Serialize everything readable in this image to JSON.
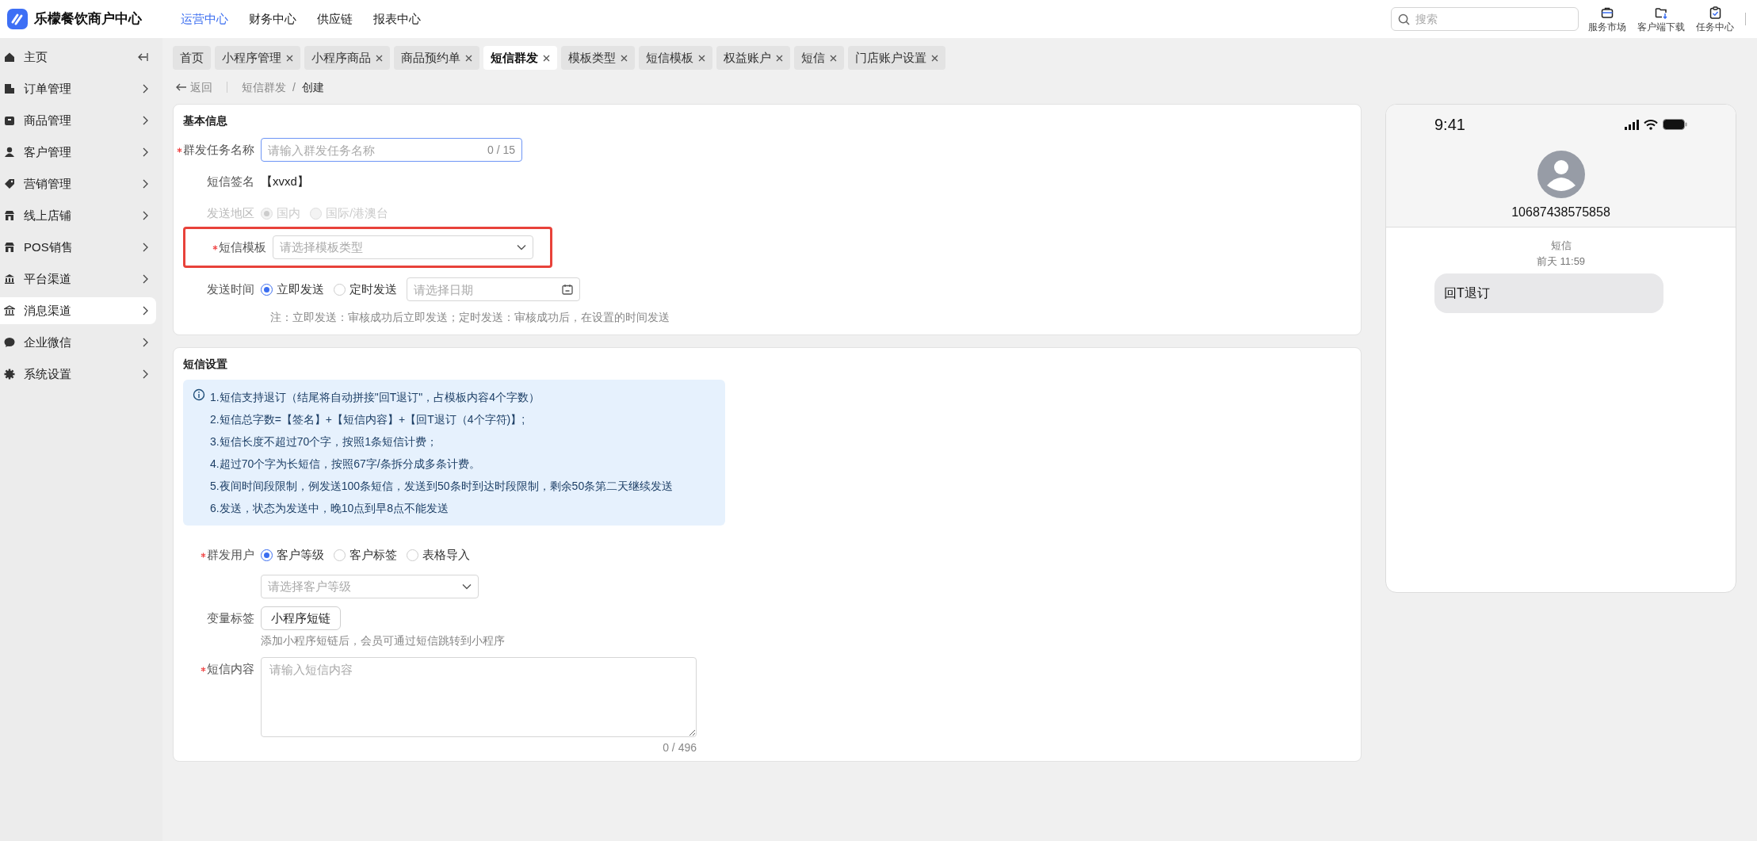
{
  "app": {
    "name": "乐檬餐饮商户中心"
  },
  "top_nav": [
    {
      "label": "运营中心",
      "selected": true
    },
    {
      "label": "财务中心",
      "selected": false
    },
    {
      "label": "供应链",
      "selected": false
    },
    {
      "label": "报表中心",
      "selected": false
    }
  ],
  "search": {
    "placeholder": "搜索"
  },
  "toolbar": [
    {
      "label": "服务市场"
    },
    {
      "label": "客户端下载"
    },
    {
      "label": "任务中心"
    }
  ],
  "sidebar": {
    "items": [
      {
        "label": "主页",
        "kind": "link",
        "selected": false
      },
      {
        "label": "订单管理",
        "kind": "group",
        "selected": false
      },
      {
        "label": "商品管理",
        "kind": "group",
        "selected": false
      },
      {
        "label": "客户管理",
        "kind": "group",
        "selected": false
      },
      {
        "label": "营销管理",
        "kind": "group",
        "selected": false
      },
      {
        "label": "线上店铺",
        "kind": "group",
        "selected": false
      },
      {
        "label": "POS销售",
        "kind": "group",
        "selected": false
      },
      {
        "label": "平台渠道",
        "kind": "group",
        "selected": false
      },
      {
        "label": "消息渠道",
        "kind": "group",
        "selected": true
      },
      {
        "label": "企业微信",
        "kind": "group",
        "selected": false
      },
      {
        "label": "系统设置",
        "kind": "group",
        "selected": false
      }
    ]
  },
  "tabs": [
    {
      "label": "首页",
      "closable": false,
      "selected": false
    },
    {
      "label": "小程序管理",
      "closable": true,
      "selected": false
    },
    {
      "label": "小程序商品",
      "closable": true,
      "selected": false
    },
    {
      "label": "商品预约单",
      "closable": true,
      "selected": false
    },
    {
      "label": "短信群发",
      "closable": true,
      "selected": true
    },
    {
      "label": "模板类型",
      "closable": true,
      "selected": false
    },
    {
      "label": "短信模板",
      "closable": true,
      "selected": false
    },
    {
      "label": "权益账户",
      "closable": true,
      "selected": false
    },
    {
      "label": "短信",
      "closable": true,
      "selected": false
    },
    {
      "label": "门店账户设置",
      "closable": true,
      "selected": false
    }
  ],
  "breadcrumb": {
    "back": "返回",
    "path": [
      "短信群发",
      "创建"
    ],
    "separator": "/"
  },
  "basic_info": {
    "title": "基本信息",
    "fields": [
      {
        "kind": "text",
        "label": "群发任务名称",
        "required": true,
        "placeholder": "请输入群发任务名称",
        "counter": "0 / 15",
        "highlighted": false
      },
      {
        "kind": "static",
        "label": "短信签名",
        "required": false,
        "value": "【xvxd】",
        "highlighted": false
      },
      {
        "kind": "radio",
        "label": "发送地区",
        "required": false,
        "disabled": true,
        "highlighted": false,
        "options": [
          {
            "label": "国内",
            "selected": true
          },
          {
            "label": "国际/港澳台",
            "selected": false
          }
        ]
      },
      {
        "kind": "select",
        "label": "短信模板",
        "required": true,
        "placeholder": "请选择模板类型",
        "highlighted": true
      },
      {
        "kind": "radio_date",
        "label": "发送时间",
        "required": false,
        "disabled": false,
        "highlighted": false,
        "options": [
          {
            "label": "立即发送",
            "selected": true
          },
          {
            "label": "定时发送",
            "selected": false
          }
        ],
        "placeholder": "请选择日期"
      }
    ],
    "note": "注：立即发送：审核成功后立即发送；定时发送：审核成功后，在设置的时间发送"
  },
  "sms_settings": {
    "title": "短信设置",
    "notes": [
      "1.短信支持退订（结尾将自动拼接\"回T退订\"，占模板内容4个字数）",
      "2.短信总字数=【签名】+【短信内容】+【回T退订（4个字符)】;",
      "3.短信长度不超过70个字，按照1条短信计费；",
      "4.超过70个字为长短信，按照67字/条拆分成多条计费。",
      "5.夜间时间段限制，例发送100条短信，发送到50条时到达时段限制，剩余50条第二天继续发送",
      "6.发送，状态为发送中，晚10点到早8点不能发送"
    ],
    "fields": [
      {
        "kind": "radio",
        "label": "群发用户",
        "required": true,
        "disabled": false,
        "options": [
          {
            "label": "客户等级",
            "selected": true
          },
          {
            "label": "客户标签",
            "selected": false
          },
          {
            "label": "表格导入",
            "selected": false
          }
        ]
      },
      {
        "kind": "select",
        "required": false,
        "placeholder": "请选择客户等级"
      },
      {
        "kind": "button",
        "label": "变量标签",
        "required": false,
        "button": "小程序短链",
        "hint": "添加小程序短链后，会员可通过短信跳转到小程序"
      },
      {
        "kind": "textarea",
        "label": "短信内容",
        "required": true,
        "placeholder": "请输入短信内容",
        "counter": "0 / 496"
      }
    ]
  },
  "preview": {
    "time": "9:41",
    "sender": "10687438575858",
    "channel": "短信",
    "timestamp": "前天 11:59",
    "message": "回T退订"
  }
}
